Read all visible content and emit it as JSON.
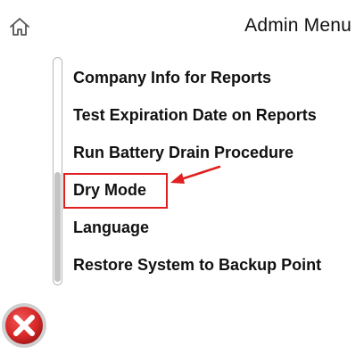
{
  "header": {
    "title": "Admin Menu",
    "home_icon": "home-icon"
  },
  "menu": {
    "items": [
      {
        "label": "Company Info for Reports"
      },
      {
        "label": "Test Expiration Date on Reports"
      },
      {
        "label": "Run Battery Drain Procedure"
      },
      {
        "label": "Dry Mode",
        "highlighted": true
      },
      {
        "label": "Language"
      },
      {
        "label": "Restore System to Backup Point"
      }
    ]
  },
  "annotation": {
    "color": "#e02020",
    "target": "Dry Mode"
  },
  "footer": {
    "close_icon": "close-icon",
    "close_color": "#d62828"
  }
}
